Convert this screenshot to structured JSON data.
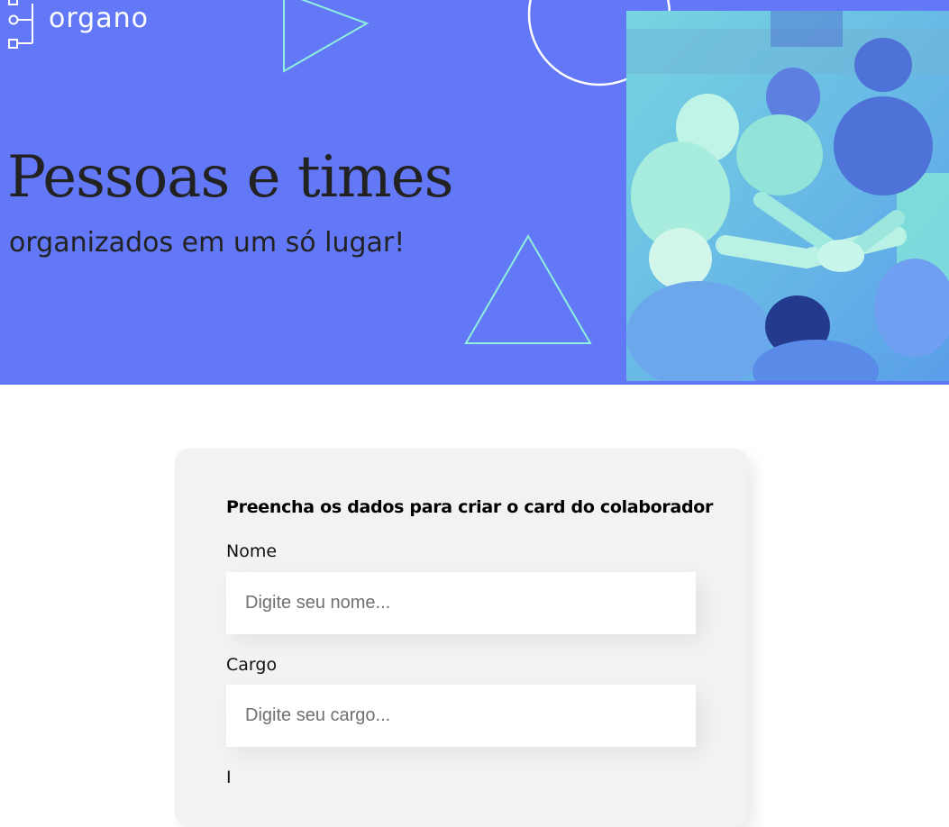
{
  "header": {
    "brand": "organo",
    "headline": "Pessoas e times",
    "subheadline": "organizados em um só lugar!",
    "photo_alt": "team-hands-together"
  },
  "form": {
    "title": "Preencha os dados para criar o card do colaborador",
    "fields": [
      {
        "label": "Nome",
        "placeholder": "Digite seu nome...",
        "value": ""
      },
      {
        "label": "Cargo",
        "placeholder": "Digite seu cargo...",
        "value": ""
      },
      {
        "label": "I",
        "placeholder": "",
        "value": ""
      }
    ]
  },
  "colors": {
    "banner_bg": "#6278f7",
    "accent_teal": "#8ef0dd",
    "card_bg": "#f2f2f2",
    "text_dark": "#222222"
  }
}
